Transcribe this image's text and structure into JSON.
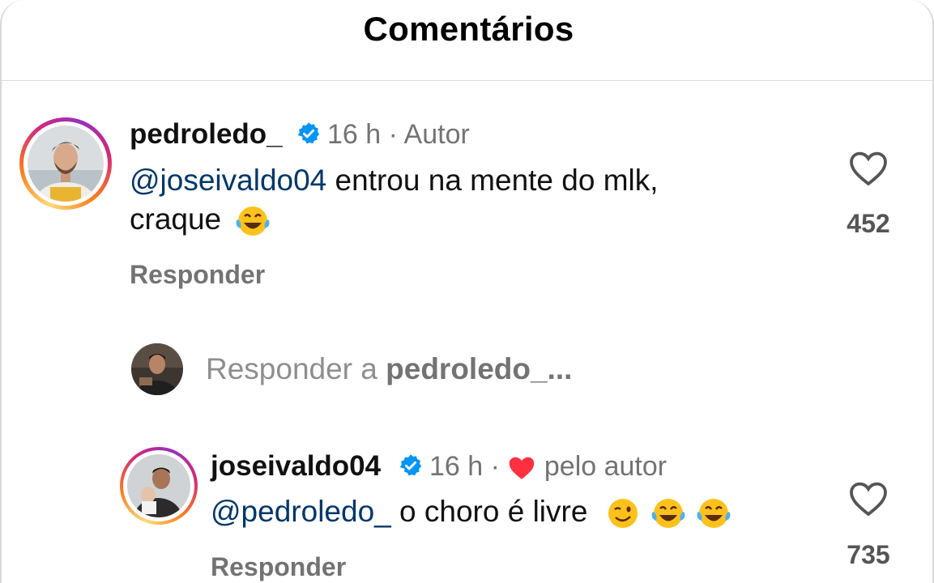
{
  "header": {
    "title": "Comentários"
  },
  "comments": [
    {
      "username": "pedroledo_",
      "time": "16 h",
      "separator": "·",
      "role": "Autor",
      "mention": "@joseivaldo04",
      "text_line1": " entrou na mente do mlk,",
      "text_line2": "craque",
      "emojis": [
        "face-with-tears-of-joy"
      ],
      "reply_label": "Responder",
      "likes": "452"
    },
    {
      "username": "joseivaldo04",
      "time": "16 h",
      "separator": "·",
      "liked_by": "pelo autor",
      "mention": "@pedroledo_",
      "text": " o choro é livre",
      "emojis": [
        "winking-face",
        "face-with-tears-of-joy",
        "face-with-tears-of-joy"
      ],
      "reply_label": "Responder",
      "likes": "735"
    }
  ],
  "reply_box": {
    "prefix": "Responder a ",
    "target": "pedroledo_..."
  },
  "colors": {
    "mention": "#00376b",
    "verified": "#0095f6",
    "heart": "#ff3040",
    "secondary_text": "#737373"
  }
}
